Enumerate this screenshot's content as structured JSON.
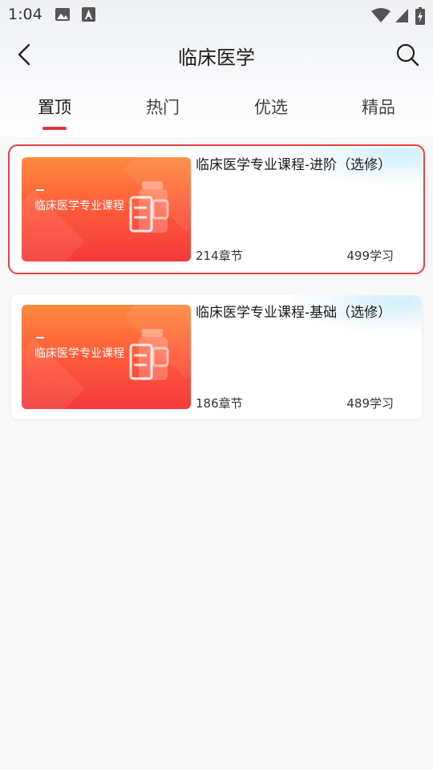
{
  "status_bar": {
    "time": "1:04"
  },
  "header": {
    "title": "临床医学"
  },
  "tabs": [
    {
      "label": "置顶",
      "active": true
    },
    {
      "label": "热门",
      "active": false
    },
    {
      "label": "优选",
      "active": false
    },
    {
      "label": "精品",
      "active": false
    }
  ],
  "courses": [
    {
      "thumb_text": "临床医学专业课程",
      "title": "临床医学专业课程-进阶（选修）",
      "chapters": "214章节",
      "students": "499学习"
    },
    {
      "thumb_text": "临床医学专业课程",
      "title": "临床医学专业课程-基础（选修）",
      "chapters": "186章节",
      "students": "489学习"
    }
  ],
  "colors": {
    "accent": "#e0353b",
    "thumb_top": "#ff8a3d",
    "thumb_bottom": "#f53a3c"
  }
}
